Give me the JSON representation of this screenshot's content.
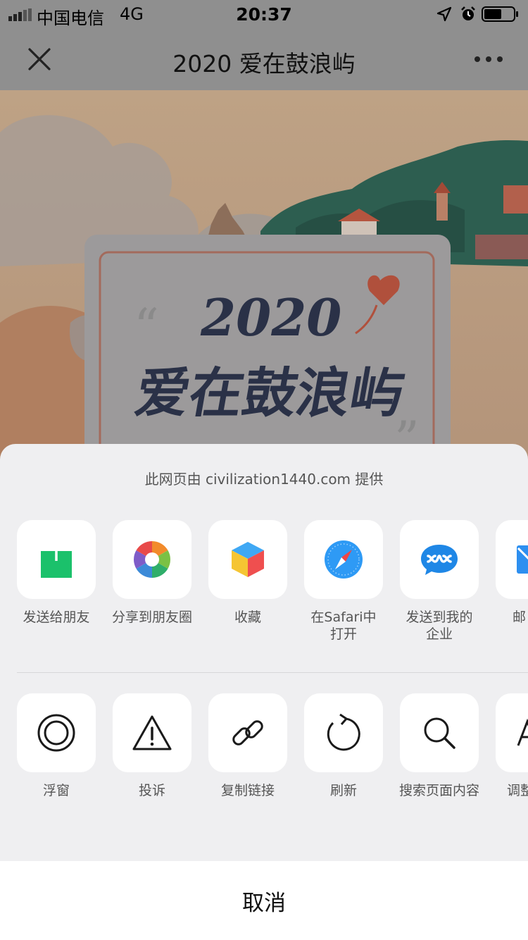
{
  "status_bar": {
    "carrier": "中国电信",
    "network": "4G",
    "time": "20:37"
  },
  "nav": {
    "title": "2020 爱在鼓浪屿"
  },
  "page_content": {
    "card_year": "2020",
    "card_title": "爱在鼓浪屿"
  },
  "sheet": {
    "provider_text": "此网页由 civilization1440.com 提供",
    "share_items": [
      {
        "label": "发送给朋友",
        "icon": "send-to-friend-icon"
      },
      {
        "label": "分享到朋友圈",
        "icon": "moments-icon"
      },
      {
        "label": "收藏",
        "icon": "favorite-cube-icon"
      },
      {
        "label": "在Safari中\n打开",
        "icon": "safari-compass-icon"
      },
      {
        "label": "发送到我的\n企业",
        "icon": "wework-icon"
      },
      {
        "label": "邮",
        "icon": "mail-icon"
      }
    ],
    "action_items": [
      {
        "label": "浮窗",
        "icon": "floating-window-icon"
      },
      {
        "label": "投诉",
        "icon": "warning-icon"
      },
      {
        "label": "复制链接",
        "icon": "link-icon"
      },
      {
        "label": "刷新",
        "icon": "refresh-icon"
      },
      {
        "label": "搜索页面内容",
        "icon": "search-icon"
      },
      {
        "label": "调整",
        "icon": "font-size-icon"
      }
    ],
    "cancel_label": "取消"
  },
  "colors": {
    "wechat_green": "#1bc16b",
    "safari_blue": "#2e9af5",
    "wework_blue": "#1f87e6",
    "mail_blue": "#2d8ff0"
  }
}
